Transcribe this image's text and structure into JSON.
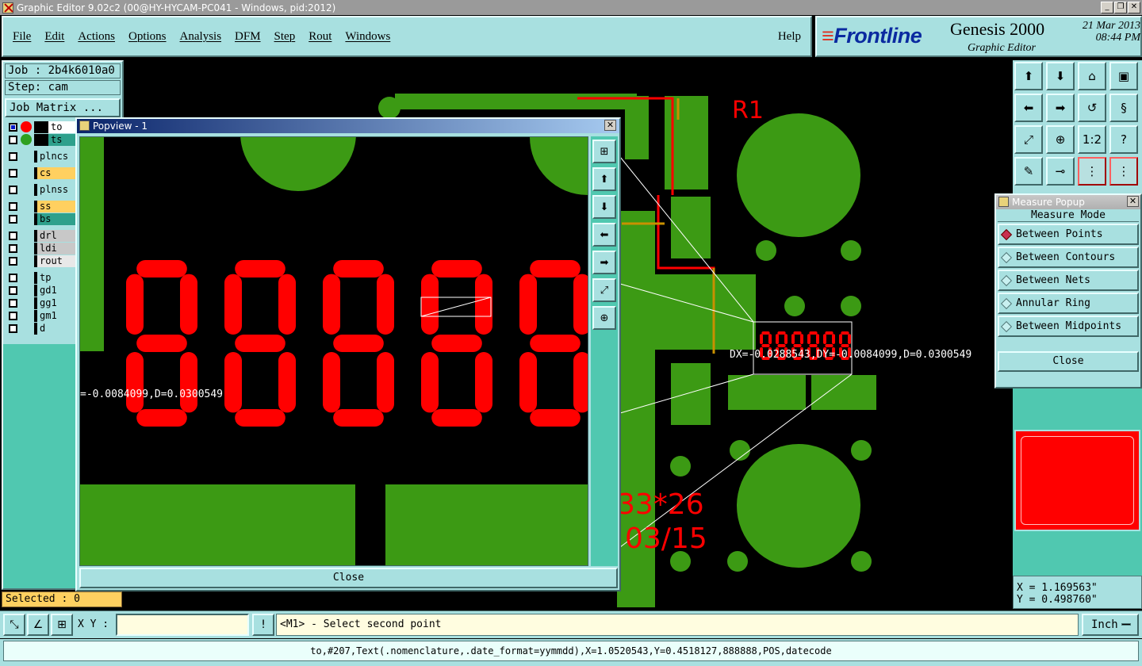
{
  "window": {
    "title": "Graphic Editor 9.02c2 (00@HY-HYCAM-PC041 - Windows, pid:2012)",
    "minimize": "_",
    "restore": "❐",
    "close": "✕"
  },
  "menu": {
    "items": [
      "File",
      "Edit",
      "Actions",
      "Options",
      "Analysis",
      "DFM",
      "Step",
      "Rout",
      "Windows"
    ],
    "help": "Help"
  },
  "brand": {
    "logo": "Frontline",
    "product": "Genesis 2000",
    "subtitle": "Graphic Editor",
    "date": "21 Mar 2013",
    "time": "08:44 PM"
  },
  "job": {
    "job_label": "Job : 2b4k6010a0",
    "step_label": "Step: cam",
    "matrix_button": "Job Matrix ..."
  },
  "layers": [
    {
      "name": "to",
      "checked": true,
      "dot": "#ff0000",
      "color": "#ffffff"
    },
    {
      "name": "ts",
      "checked": false,
      "dot": "#2ea020",
      "color": "#2ea08c"
    },
    {
      "name": "plncs",
      "checked": false,
      "dot": "",
      "color": "#a8e0e0"
    },
    {
      "name": "cs",
      "checked": false,
      "dot": "",
      "color": "#ffd060"
    },
    {
      "name": "plnss",
      "checked": false,
      "dot": "",
      "color": "#a8e0e0"
    },
    {
      "name": "ss",
      "checked": false,
      "dot": "",
      "color": "#ffd060"
    },
    {
      "name": "bs",
      "checked": false,
      "dot": "",
      "color": "#2ea08c"
    },
    {
      "name": "drl",
      "checked": false,
      "dot": "",
      "color": "#c8c8c8"
    },
    {
      "name": "ldi",
      "checked": false,
      "dot": "",
      "color": "#c8c8c8"
    },
    {
      "name": "rout",
      "checked": false,
      "dot": "",
      "color": "#e8e8e8"
    },
    {
      "name": "tp",
      "checked": false,
      "dot": "",
      "color": "#a8e0e0"
    },
    {
      "name": "gd1",
      "checked": false,
      "dot": "",
      "color": "#a8e0e0"
    },
    {
      "name": "gg1",
      "checked": false,
      "dot": "",
      "color": "#a8e0e0"
    },
    {
      "name": "gm1",
      "checked": false,
      "dot": "",
      "color": "#a8e0e0"
    },
    {
      "name": "d",
      "checked": false,
      "dot": "",
      "color": "#a8e0e0"
    }
  ],
  "selected": "Selected : 0",
  "canvas": {
    "ref_label": "R1",
    "measure_readout": "DX=-0.0288543,DY=-0.0084099,D=0.0300549",
    "date_code_1": "33*26",
    "date_code_2": "03/15",
    "board_green": "#3c9a14",
    "copper_red": "#ff0000",
    "trace_orange": "#c89000"
  },
  "popview": {
    "title": "Popview - 1",
    "readout": "=-0.0084099,D=0.0300549",
    "close": "Close",
    "close_x": "✕"
  },
  "measure_popup": {
    "title": "Measure Popup",
    "mode_header": "Measure Mode",
    "options": [
      {
        "label": "Between Points",
        "selected": true
      },
      {
        "label": "Between Contours",
        "selected": false
      },
      {
        "label": "Between Nets",
        "selected": false
      },
      {
        "label": "Annular Ring",
        "selected": false
      },
      {
        "label": "Between Midpoints",
        "selected": false
      }
    ],
    "close": "Close",
    "close_x": "✕"
  },
  "right_tools": {
    "ratio_label": "1:2",
    "help_label": "?"
  },
  "coords": {
    "x": "X = 1.169563\"",
    "y": "Y = 0.498760\""
  },
  "bottom": {
    "xy_label": "X Y :",
    "xy_value": "",
    "warn": "!",
    "prompt": "<M1> - Select second point",
    "units": "Inch"
  },
  "status": "to,#207,Text(.nomenclature,.date_format=yymmdd),X=1.0520543,Y=0.4518127,888888,POS,datecode"
}
